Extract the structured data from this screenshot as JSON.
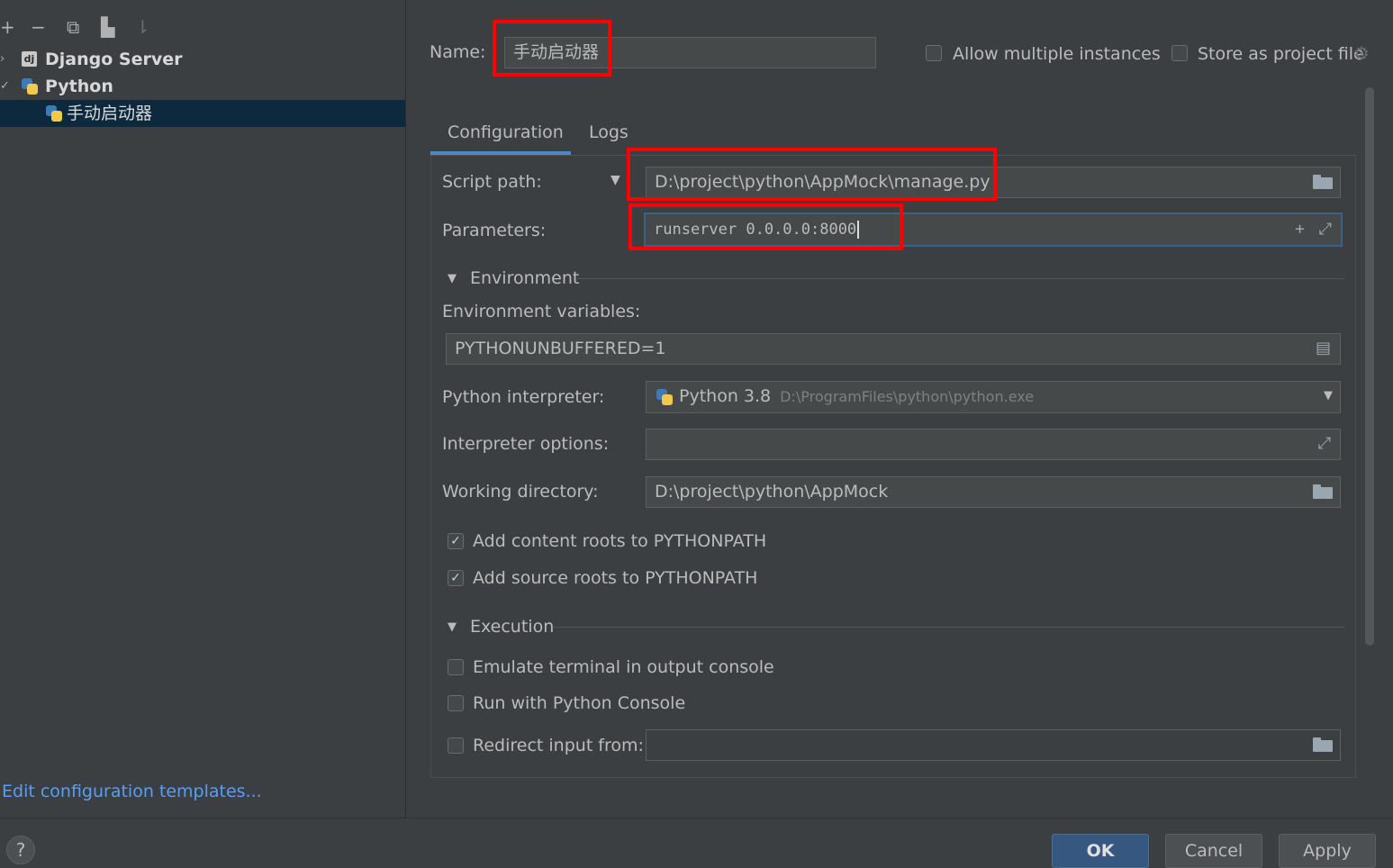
{
  "toolbar": {
    "add_icon": "plus-icon",
    "remove_icon": "minus-icon",
    "copy_icon": "copy-icon",
    "folder_icon": "new-folder-icon",
    "sort_icon": "sort-icon"
  },
  "tree": {
    "items": [
      {
        "label": "Django Server",
        "icon": "django-icon"
      },
      {
        "label": "Python",
        "icon": "python-icon"
      },
      {
        "label": "手动启动器",
        "icon": "python-icon"
      }
    ]
  },
  "left": {
    "edit_templates": "Edit configuration templates..."
  },
  "name_row": {
    "label": "Name:",
    "value": "手动启动器",
    "allow_multiple": "Allow multiple instances",
    "store_project": "Store as project file"
  },
  "tabs": [
    "Configuration",
    "Logs"
  ],
  "form": {
    "script_path_label": "Script path:",
    "script_path_value": "D:\\project\\python\\AppMock\\manage.py",
    "parameters_label": "Parameters:",
    "parameters_value": "runserver 0.0.0.0:8000",
    "environment_section": "Environment",
    "env_vars_label": "Environment variables:",
    "env_vars_value": "PYTHONUNBUFFERED=1",
    "interpreter_label": "Python interpreter:",
    "interpreter_name": "Python 3.8",
    "interpreter_path": "D:\\ProgramFiles\\python\\python.exe",
    "interpreter_options_label": "Interpreter options:",
    "interpreter_options_value": "",
    "working_dir_label": "Working directory:",
    "working_dir_value": "D:\\project\\python\\AppMock",
    "add_content_roots": "Add content roots to PYTHONPATH",
    "add_source_roots": "Add source roots to PYTHONPATH",
    "execution_section": "Execution",
    "emulate_terminal": "Emulate terminal in output console",
    "run_python_console": "Run with Python Console",
    "redirect_input": "Redirect input from:",
    "redirect_input_value": ""
  },
  "buttons": {
    "help": "?",
    "ok": "OK",
    "cancel": "Cancel",
    "apply": "Apply"
  },
  "colors": {
    "background": "#3c3f41",
    "selection": "#0d293e",
    "link": "#589df6",
    "highlight": "#ff0000",
    "primary_button": "#365880"
  }
}
